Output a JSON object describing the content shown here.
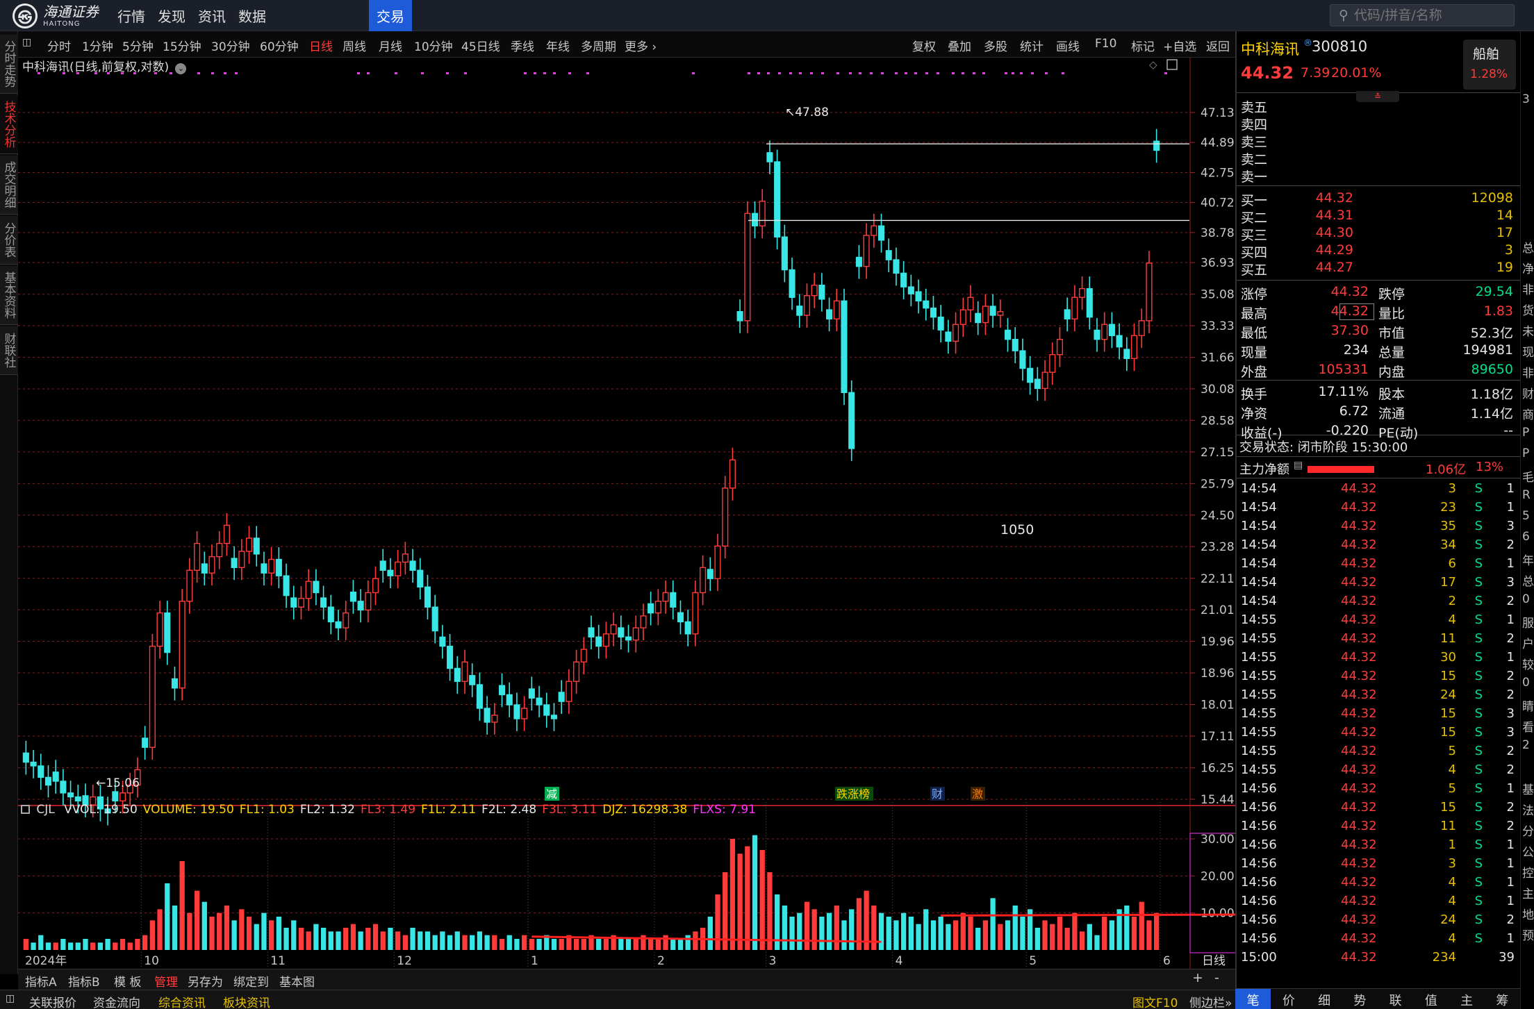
{
  "app": {
    "logo_symbol": "㉿",
    "logo_text": "海通证券",
    "logo_sub": "HAITONG",
    "nav": [
      "行情",
      "发现",
      "资讯",
      "数据",
      "交易"
    ],
    "nav_active": "交易",
    "search_placeholder": "代码/拼音/名称"
  },
  "left_tabs": [
    "分时走势",
    "技术分析",
    "成交明细",
    "分价表",
    "基本资料",
    "财联社"
  ],
  "left_tab_active": "技术分析",
  "period_bar": {
    "periods": [
      "分时",
      "1分钟",
      "5分钟",
      "15分钟",
      "30分钟",
      "60分钟",
      "日线",
      "周线",
      "月线",
      "10分钟",
      "45日线",
      "季线",
      "年线",
      "多周期",
      "更多 ›"
    ],
    "active": "日线",
    "tools": [
      "复权",
      "叠加",
      "多股",
      "统计",
      "画线",
      "F10",
      "标记",
      "+自选",
      "返回"
    ]
  },
  "chart_title": "中科海讯(日线,前复权,对数)",
  "annotation_1050": "1050",
  "marker_labels": {
    "jian": "减",
    "zdb": "跌涨榜",
    "cai": "财",
    "ji": "激"
  },
  "date_labels": [
    "2024年",
    "10",
    "11",
    "12",
    "1",
    "2",
    "3",
    "4",
    "5",
    "6"
  ],
  "chart_data": [
    {
      "type": "candlestick",
      "title": "中科海讯(日线,前复权,对数)",
      "y_scale": "log",
      "y_ticks": [
        47.13,
        44.89,
        42.75,
        40.72,
        38.78,
        36.93,
        35.08,
        33.33,
        31.66,
        30.08,
        28.58,
        27.15,
        25.79,
        24.5,
        23.28,
        22.11,
        21.01,
        19.96,
        18.96,
        18.01,
        17.11,
        16.25,
        15.44
      ],
      "max_label": "47.88",
      "min_label": "15.06",
      "x_categories": [
        "2024年",
        "10",
        "11",
        "12",
        "1",
        "2",
        "3",
        "4",
        "5",
        "6"
      ],
      "series": [
        {
          "name": "日线",
          "values": [
            16.4,
            16.3,
            16.0,
            15.8,
            15.9,
            15.6,
            15.5,
            15.4,
            15.3,
            15.5,
            15.2,
            15.1,
            15.4,
            15.6,
            15.8,
            16.2,
            16.8,
            19.8,
            20.9,
            19.6,
            18.5,
            21.3,
            22.4,
            23.4,
            22.3,
            22.9,
            23.4,
            24.1,
            22.5,
            23.1,
            23.6,
            23.0,
            22.3,
            22.8,
            22.2,
            21.5,
            21.1,
            21.4,
            22.0,
            21.6,
            21.1,
            20.6,
            20.4,
            20.9,
            21.3,
            21.0,
            21.6,
            22.1,
            22.4,
            22.2,
            22.7,
            23.0,
            22.4,
            21.8,
            21.1,
            20.3,
            19.8,
            19.1,
            18.7,
            19.3,
            18.6,
            17.9,
            17.5,
            17.7,
            18.3,
            18.0,
            17.6,
            17.9,
            18.2,
            18.0,
            17.7,
            17.6,
            18.1,
            18.7,
            19.3,
            19.7,
            20.1,
            19.8,
            20.2,
            20.5,
            20.1,
            20.0,
            20.4,
            20.8,
            20.9,
            21.3,
            21.6,
            21.1,
            20.6,
            20.2,
            21.6,
            22.5,
            22.1,
            23.3,
            25.6,
            26.8,
            33.6,
            40.0,
            39.2,
            40.8,
            43.5,
            38.5,
            36.5,
            34.9,
            33.9,
            35.0,
            35.6,
            34.8,
            33.7,
            34.7,
            29.9,
            27.3,
            36.7,
            38.6,
            39.2,
            38.3,
            37.1,
            36.3,
            35.5,
            35.1,
            34.7,
            34.3,
            33.8,
            33.1,
            32.5,
            33.4,
            34.2,
            34.9,
            33.5,
            34.4,
            33.9,
            34.1,
            32.6,
            32.0,
            31.1,
            30.4,
            30.1,
            30.9,
            31.8,
            32.6,
            33.7,
            34.9,
            35.4,
            33.8,
            32.6,
            33.4,
            32.8,
            32.2,
            31.6,
            32.8,
            33.6,
            36.9,
            44.32
          ]
        }
      ],
      "last_close": 44.32
    },
    {
      "type": "bar",
      "title": "CJL",
      "y_ticks": [
        30.0,
        20.0,
        10.0
      ],
      "legend": [
        {
          "name": "VVOL",
          "value": "19.50",
          "color": "#e8e8e8"
        },
        {
          "name": "VOLUME",
          "value": "19.50",
          "color": "#ffd400"
        },
        {
          "name": "FL1",
          "value": "1.03",
          "color": "#ffd400"
        },
        {
          "name": "FL2",
          "value": "1.32",
          "color": "#e8e8e8"
        },
        {
          "name": "FL3",
          "value": "1.49",
          "color": "#ff3b3b"
        },
        {
          "name": "F1L",
          "value": "2.11",
          "color": "#ffd400"
        },
        {
          "name": "F2L",
          "value": "2.48",
          "color": "#e8e8e8"
        },
        {
          "name": "F3L",
          "value": "3.11",
          "color": "#ff3b3b"
        },
        {
          "name": "DJZ",
          "value": "16298.38",
          "color": "#ffd400"
        },
        {
          "name": "FLXS",
          "value": "7.91",
          "color": "#ff33ff"
        }
      ],
      "series": [
        {
          "name": "VOLUME",
          "values": [
            3,
            2,
            4,
            2,
            2,
            3,
            2,
            2,
            3,
            2,
            2,
            3,
            2,
            3,
            2,
            3,
            4,
            8,
            11,
            18,
            12,
            24,
            10,
            16,
            13,
            9,
            10,
            12,
            8,
            11,
            9,
            7,
            10,
            8,
            9,
            6,
            8,
            6,
            5,
            7,
            6,
            5,
            5,
            6,
            7,
            5,
            6,
            7,
            5,
            6,
            5,
            4,
            6,
            5,
            5,
            4,
            5,
            4,
            5,
            4,
            4,
            5,
            4,
            4,
            3,
            4,
            3,
            4,
            3,
            3,
            4,
            3,
            3,
            4,
            3,
            3,
            4,
            3,
            3,
            4,
            3,
            3,
            3,
            4,
            3,
            3,
            4,
            3,
            3,
            4,
            5,
            6,
            9,
            15,
            21,
            30,
            26,
            28,
            31,
            27,
            21,
            15,
            12,
            9,
            10,
            13,
            11,
            9,
            10,
            12,
            8,
            11,
            14,
            16,
            12,
            10,
            9,
            8,
            10,
            9,
            7,
            11,
            8,
            9,
            7,
            8,
            10,
            9,
            6,
            8,
            14,
            7,
            8,
            12,
            9,
            11,
            6,
            8,
            7,
            9,
            6,
            10,
            5,
            7,
            4,
            9,
            8,
            11,
            12,
            9,
            13,
            8,
            10,
            7,
            10,
            8,
            12,
            11,
            7,
            10,
            8,
            12,
            19,
            20,
            8
          ]
        }
      ]
    }
  ],
  "right_panel": {
    "stock_name": "中科海讯",
    "stock_code": "300810",
    "price": "44.32",
    "change": "7.39",
    "change_pct": "20.01%",
    "sector": "船舶",
    "sector_pct": "1.28%",
    "sell_rows": [
      {
        "label": "卖五"
      },
      {
        "label": "卖四"
      },
      {
        "label": "卖三"
      },
      {
        "label": "卖二"
      },
      {
        "label": "卖一"
      }
    ],
    "buy_rows": [
      {
        "label": "买一",
        "price": "44.32",
        "vol": "12098"
      },
      {
        "label": "买二",
        "price": "44.31",
        "vol": "14"
      },
      {
        "label": "买三",
        "price": "44.30",
        "vol": "17"
      },
      {
        "label": "买四",
        "price": "44.29",
        "vol": "3"
      },
      {
        "label": "买五",
        "price": "44.27",
        "vol": "19"
      }
    ],
    "stats": [
      {
        "l1": "涨停",
        "v1": "44.32",
        "l2": "跌停",
        "v2": "29.54"
      },
      {
        "l1": "最高",
        "v1": "44.32",
        "l2": "量比",
        "v2": "1.83"
      },
      {
        "l1": "最低",
        "v1": "37.30",
        "l2": "市值",
        "v2": "52.3亿"
      },
      {
        "l1": "现量",
        "v1": "234",
        "l2": "总量",
        "v2": "194981"
      },
      {
        "l1": "外盘",
        "v1": "105331",
        "l2": "内盘",
        "v2": "89650"
      }
    ],
    "stats2": [
      {
        "l1": "换手",
        "v1": "17.11%",
        "l2": "股本",
        "v2": "1.18亿"
      },
      {
        "l1": "净资",
        "v1": "6.72",
        "l2": "流通",
        "v2": "1.14亿"
      },
      {
        "l1": "收益(-)",
        "v1": "-0.220",
        "l2": "PE(动)",
        "v2": "--"
      }
    ],
    "trade_status": "交易状态: 闭市阶段 15:30:00",
    "net_flow_label": "主力净额",
    "net_flow_value": "1.06亿",
    "net_flow_pct": "13%",
    "ticks": [
      {
        "t": "14:54",
        "p": "44.32",
        "v": "3",
        "f": "S",
        "n": "1"
      },
      {
        "t": "14:54",
        "p": "44.32",
        "v": "23",
        "f": "S",
        "n": "1"
      },
      {
        "t": "14:54",
        "p": "44.32",
        "v": "35",
        "f": "S",
        "n": "3"
      },
      {
        "t": "14:54",
        "p": "44.32",
        "v": "34",
        "f": "S",
        "n": "2"
      },
      {
        "t": "14:54",
        "p": "44.32",
        "v": "6",
        "f": "S",
        "n": "1"
      },
      {
        "t": "14:54",
        "p": "44.32",
        "v": "17",
        "f": "S",
        "n": "3"
      },
      {
        "t": "14:54",
        "p": "44.32",
        "v": "2",
        "f": "S",
        "n": "2"
      },
      {
        "t": "14:55",
        "p": "44.32",
        "v": "4",
        "f": "S",
        "n": "1"
      },
      {
        "t": "14:55",
        "p": "44.32",
        "v": "11",
        "f": "S",
        "n": "2"
      },
      {
        "t": "14:55",
        "p": "44.32",
        "v": "30",
        "f": "S",
        "n": "1"
      },
      {
        "t": "14:55",
        "p": "44.32",
        "v": "15",
        "f": "S",
        "n": "2"
      },
      {
        "t": "14:55",
        "p": "44.32",
        "v": "24",
        "f": "S",
        "n": "2"
      },
      {
        "t": "14:55",
        "p": "44.32",
        "v": "15",
        "f": "S",
        "n": "3"
      },
      {
        "t": "14:55",
        "p": "44.32",
        "v": "15",
        "f": "S",
        "n": "3"
      },
      {
        "t": "14:55",
        "p": "44.32",
        "v": "5",
        "f": "S",
        "n": "2"
      },
      {
        "t": "14:55",
        "p": "44.32",
        "v": "4",
        "f": "S",
        "n": "2"
      },
      {
        "t": "14:56",
        "p": "44.32",
        "v": "5",
        "f": "S",
        "n": "1"
      },
      {
        "t": "14:56",
        "p": "44.32",
        "v": "15",
        "f": "S",
        "n": "2"
      },
      {
        "t": "14:56",
        "p": "44.32",
        "v": "11",
        "f": "S",
        "n": "2"
      },
      {
        "t": "14:56",
        "p": "44.32",
        "v": "1",
        "f": "S",
        "n": "1"
      },
      {
        "t": "14:56",
        "p": "44.32",
        "v": "3",
        "f": "S",
        "n": "1"
      },
      {
        "t": "14:56",
        "p": "44.32",
        "v": "4",
        "f": "S",
        "n": "1"
      },
      {
        "t": "14:56",
        "p": "44.32",
        "v": "4",
        "f": "S",
        "n": "1"
      },
      {
        "t": "14:56",
        "p": "44.32",
        "v": "24",
        "f": "S",
        "n": "2"
      },
      {
        "t": "14:56",
        "p": "44.32",
        "v": "4",
        "f": "S",
        "n": "1"
      },
      {
        "t": "15:00",
        "p": "44.32",
        "v": "234",
        "f": "",
        "n": "39"
      }
    ],
    "tabs": [
      "笔",
      "价",
      "细",
      "势",
      "联",
      "值",
      "主",
      "筹"
    ],
    "tab_active": "笔"
  },
  "bottom": {
    "row1": [
      "指标A",
      "指标B",
      "模 板",
      "管理",
      "另存为",
      "绑定到",
      "基本图"
    ],
    "row1_active": "管理",
    "row1_right": [
      "+",
      "-"
    ],
    "period_label": "日线",
    "row2": [
      "关联报价",
      "资金流向",
      "综合资讯",
      "板块资讯"
    ],
    "row2_hl": [
      "综合资讯",
      "板块资讯"
    ],
    "row2_right": "图文F10",
    "row2_right2": "侧边栏»"
  },
  "edge_chars": [
    "3",
    "",
    "",
    "",
    "",
    "",
    "",
    "总",
    "净",
    "非",
    "货",
    "未",
    "现",
    "非",
    "财",
    "商",
    "P",
    "P",
    "毛",
    "R",
    "5",
    "6",
    "年",
    "总",
    "0",
    "服",
    "户",
    "较",
    "0",
    "睛",
    "看",
    "2",
    "",
    "基",
    "法",
    "分",
    "公",
    "控",
    "主",
    "地",
    "预"
  ],
  "colors": {
    "up": "#ff3b3b",
    "down": "#39e6e6",
    "accent": "#1e5bd8",
    "grid": "#8a1f1f"
  }
}
